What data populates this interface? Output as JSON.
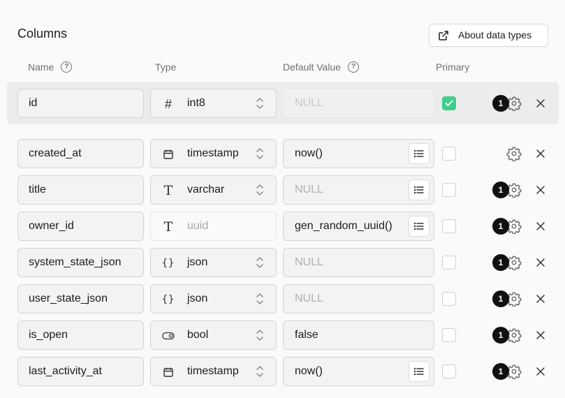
{
  "title": "Columns",
  "about_button": {
    "label": "About data types",
    "icon": "external-link-icon"
  },
  "headers": {
    "name": "Name",
    "type": "Type",
    "default": "Default Value",
    "primary": "Primary"
  },
  "rows": [
    {
      "name": "id",
      "type": "int8",
      "type_icon": "#",
      "default": "NULL",
      "default_state": "disabled",
      "primary": true,
      "badge": "1",
      "has_list": false
    },
    {
      "name": "created_at",
      "type": "timestamp",
      "type_icon": "calendar",
      "default": "now()",
      "default_state": "value",
      "primary": false,
      "badge": "",
      "has_list": true
    },
    {
      "name": "title",
      "type": "varchar",
      "type_icon": "T",
      "default": "NULL",
      "default_state": "placeholder",
      "primary": false,
      "badge": "1",
      "has_list": true
    },
    {
      "name": "owner_id",
      "type": "uuid",
      "type_icon": "T",
      "type_disabled": true,
      "default": "gen_random_uuid()",
      "default_state": "value",
      "primary": false,
      "badge": "1",
      "has_list": true
    },
    {
      "name": "system_state_json",
      "type": "json",
      "type_icon": "{}",
      "default": "NULL",
      "default_state": "placeholder",
      "primary": false,
      "badge": "1",
      "has_list": false
    },
    {
      "name": "user_state_json",
      "type": "json",
      "type_icon": "{}",
      "default": "NULL",
      "default_state": "placeholder",
      "primary": false,
      "badge": "1",
      "has_list": false
    },
    {
      "name": "is_open",
      "type": "bool",
      "type_icon": "toggle",
      "default": "false",
      "default_state": "value",
      "primary": false,
      "badge": "1",
      "has_list": false
    },
    {
      "name": "last_activity_at",
      "type": "timestamp",
      "type_icon": "calendar",
      "default": "now()",
      "default_state": "value",
      "primary": false,
      "badge": "1",
      "has_list": true
    }
  ],
  "colors": {
    "accent": "#3ecf8e",
    "badge": "#111111"
  }
}
